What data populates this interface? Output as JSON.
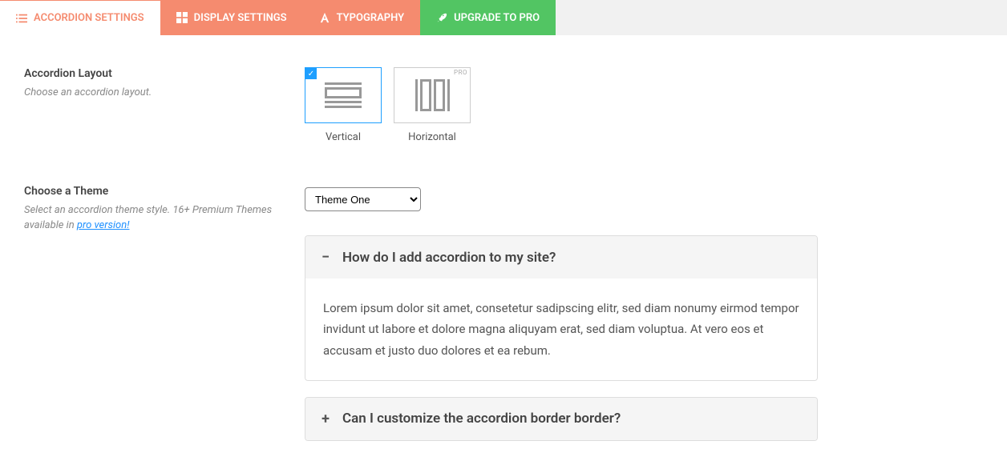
{
  "tabs": {
    "t0": "ACCORDION SETTINGS",
    "t1": "DISPLAY SETTINGS",
    "t2": "TYPOGRAPHY",
    "t3": "UPGRADE TO PRO"
  },
  "layout": {
    "title": "Accordion Layout",
    "desc": "Choose an accordion layout.",
    "opt_vertical": "Vertical",
    "opt_horizontal": "Horizontal",
    "pro_badge": "PRO"
  },
  "theme": {
    "title": "Choose a Theme",
    "desc_prefix": "Select an accordion theme style. 16+ Premium Themes available in ",
    "desc_link": "pro version!",
    "selected": "Theme One"
  },
  "accordion": {
    "items": [
      {
        "expanded": true,
        "toggle": "−",
        "title": "How do I add accordion to my site?",
        "body": "Lorem ipsum dolor sit amet, consetetur sadipscing elitr, sed diam nonumy eirmod tempor invidunt ut labore et dolore magna aliquyam erat, sed diam voluptua. At vero eos et accusam et justo duo dolores et ea rebum."
      },
      {
        "expanded": false,
        "toggle": "+",
        "title": "Can I customize the accordion border border?"
      }
    ]
  }
}
